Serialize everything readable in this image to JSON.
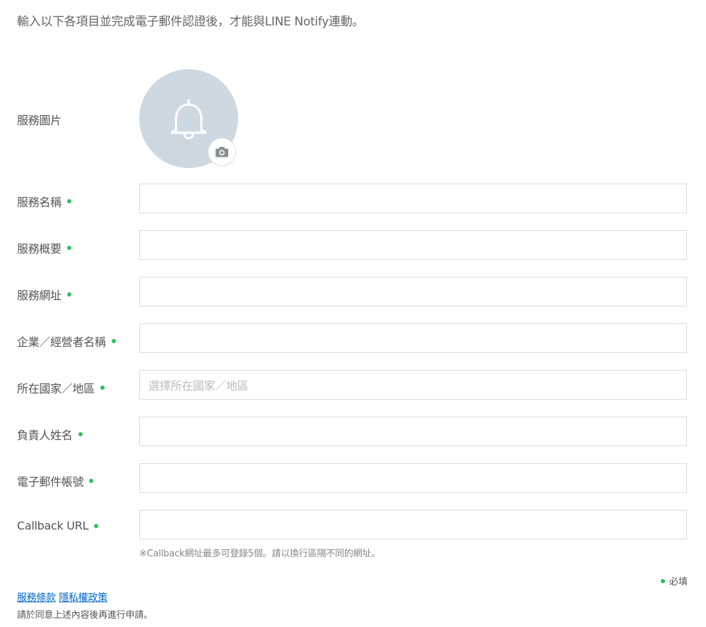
{
  "intro": "輸入以下各項目並完成電子郵件認證後，才能與LINE Notify連動。",
  "form": {
    "service_image_label": "服務圖片",
    "fields": [
      {
        "label": "服務名稱",
        "value": "",
        "required": true
      },
      {
        "label": "服務概要",
        "value": "",
        "required": true
      },
      {
        "label": "服務網址",
        "value": "",
        "required": true
      },
      {
        "label": "企業／經營者名稱",
        "value": "",
        "required": true
      },
      {
        "label": "所在國家／地區",
        "placeholder": "選擇所在國家／地區",
        "required": true
      },
      {
        "label": "負責人姓名",
        "value": "",
        "required": true
      },
      {
        "label": "電子郵件帳號",
        "value": "",
        "required": true
      },
      {
        "label": "Callback URL",
        "value": "",
        "required": true
      }
    ],
    "callback_note": "※Callback網址最多可登錄5個。請以換行區隔不同的網址。",
    "required_legend": "必填"
  },
  "footer": {
    "terms_link": "服務條款",
    "privacy_link": "隱私權政策",
    "agree_text": "請於同意上述內容後再進行申請。"
  },
  "icons": {
    "avatar_placeholder": "bell-icon",
    "upload": "camera-icon"
  },
  "colors": {
    "required_dot": "#2bc25b",
    "avatar_bg": "#cdd8e0",
    "link": "#0066cc",
    "border": "#d9dcdf"
  }
}
